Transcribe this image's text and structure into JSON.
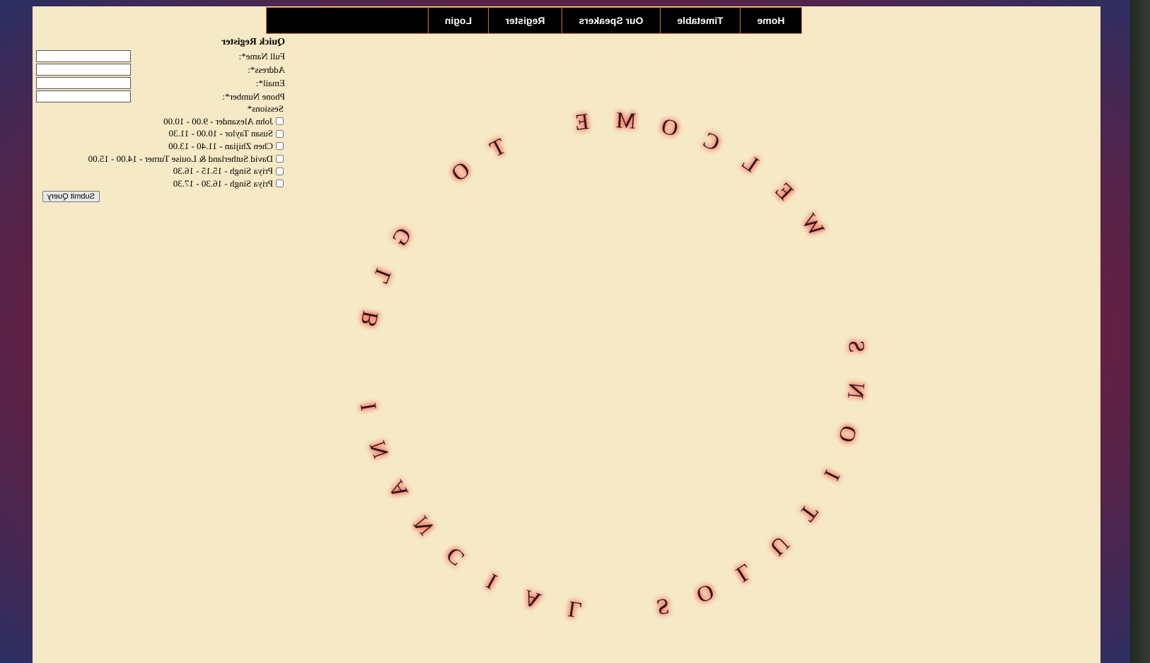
{
  "nav": {
    "items": [
      "Home",
      "Timetable",
      "Our Speakers",
      "Register",
      "Login"
    ]
  },
  "quick_register": {
    "title": "Quick Register",
    "fields": [
      {
        "label": "Full Name*:",
        "value": ""
      },
      {
        "label": "Address*:",
        "value": ""
      },
      {
        "label": "Email*:",
        "value": ""
      },
      {
        "label": "Phone Number*:",
        "value": ""
      }
    ],
    "sessions_title": "Sessions*",
    "sessions": [
      "John Alexander - 9.00 - 10.00",
      "Susan Taylor - 10.00 - 11.30",
      "Chen Zhijian - 11.40 - 13.00",
      "David Sutherland & Louise Turner - 14.00 - 15.00",
      "Priya Singh - 15.15 - 16.30",
      "Priya Singh - 16.30 - 17.30"
    ],
    "submit_label": "Submit Query"
  },
  "welcome_text": "WELCOME TO GLB INANCIAL SOLUTIONS",
  "colors": {
    "page_bg": "#f5e9c6",
    "nav_bg": "#000000",
    "nav_border": "#c8801f",
    "glow": "#ff3b3b"
  }
}
